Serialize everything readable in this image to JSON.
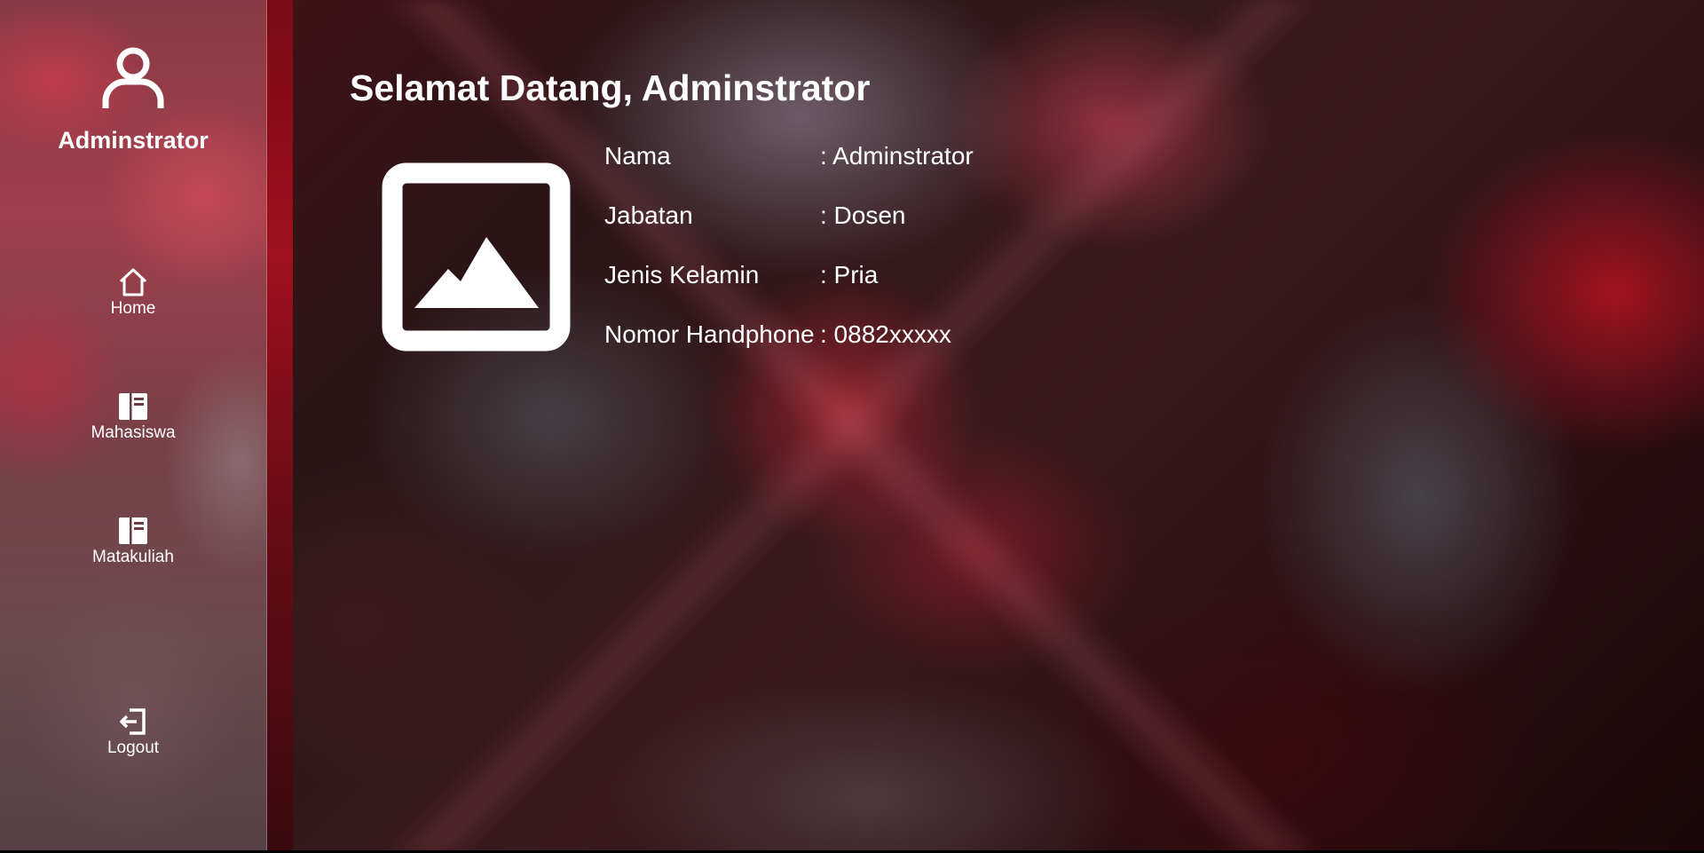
{
  "sidebar": {
    "user_name": "Adminstrator",
    "user_icon": "user-icon",
    "nav": {
      "home": {
        "label": "Home",
        "icon": "home-icon"
      },
      "mahasiswa": {
        "label": "Mahasiswa",
        "icon": "book-icon"
      },
      "matakuliah": {
        "label": "Matakuliah",
        "icon": "book-icon"
      },
      "logout": {
        "label": "Logout",
        "icon": "logout-icon"
      }
    }
  },
  "main": {
    "title": "Selamat Datang, Adminstrator",
    "photo_icon": "image-placeholder-icon",
    "profile": [
      {
        "label": "Nama",
        "value": ": Adminstrator"
      },
      {
        "label": "Jabatan",
        "value": ": Dosen"
      },
      {
        "label": "Jenis Kelamin",
        "value": ": Pria"
      },
      {
        "label": "Nomor Handphone",
        "value": ": 0882xxxxx"
      }
    ]
  },
  "colors": {
    "text": "#ffffff",
    "accent_red": "#a01020"
  }
}
